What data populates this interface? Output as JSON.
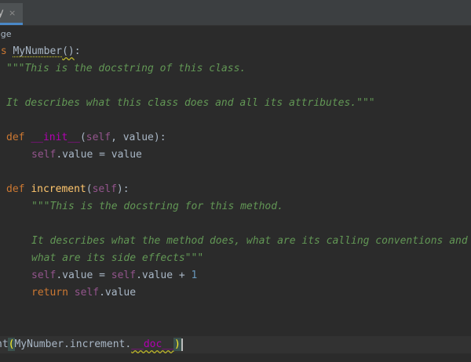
{
  "tab": {
    "name": "y",
    "close_glyph": "×"
  },
  "breadcrumb": {
    "text": "age"
  },
  "code": {
    "l1": {
      "kw": "ss",
      "name": "MyNumber",
      "paren": "()",
      "colon": ":"
    },
    "l2": {
      "doc": "\"\"\"This is the docstring of this class."
    },
    "l3": {
      "doc": "It describes what this class does and all its attributes.\"\"\""
    },
    "l4": {
      "kw": "def",
      "fn": "__init__",
      "open": "(",
      "self": "self",
      "rest": ", value):"
    },
    "l5": {
      "self": "self",
      "rest": ".value = value"
    },
    "l6": {
      "kw": "def",
      "fn": "increment",
      "open": "(",
      "self": "self",
      "rest": "):"
    },
    "l7": {
      "doc": "\"\"\"This is the docstring for this method."
    },
    "l8": {
      "doc": "It describes what the method does, what are its calling conventions and"
    },
    "l9": {
      "doc": "what are its side effects\"\"\""
    },
    "l10": {
      "self1": "self",
      "mid": ".value = ",
      "self2": "self",
      "rest": ".value + ",
      "num": "1"
    },
    "l11": {
      "kw": "return",
      "self": "self",
      "rest": ".value"
    },
    "l12": {
      "pre": "nt",
      "open": "(",
      "obj": "MyNumber.increment.",
      "dunder": "__doc__",
      "close": ")"
    }
  }
}
